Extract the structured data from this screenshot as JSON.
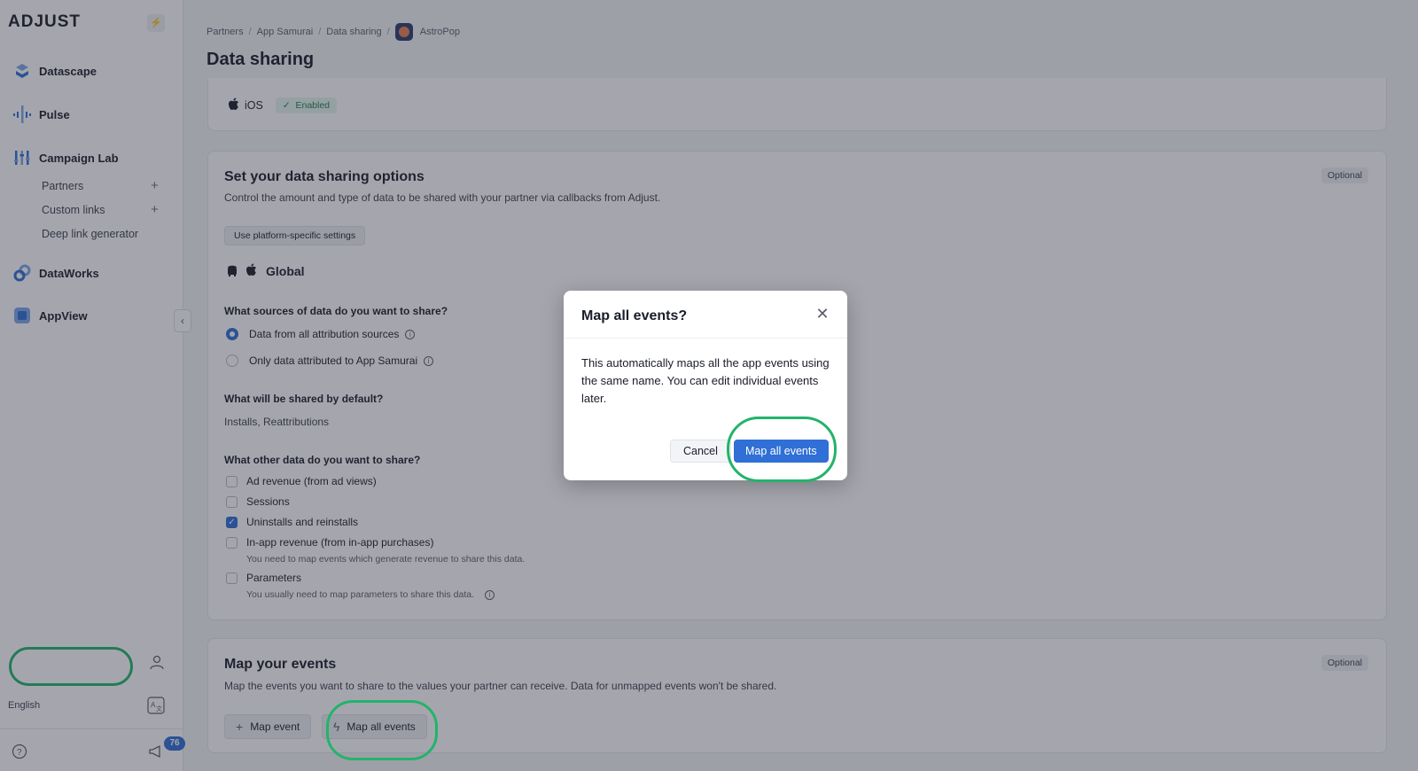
{
  "sidebar": {
    "logo": "ADJUST",
    "nav": [
      {
        "label": "Datascape",
        "icon": "datascape-icon"
      },
      {
        "label": "Pulse",
        "icon": "pulse-icon"
      },
      {
        "label": "Campaign Lab",
        "icon": "campaign-lab-icon"
      },
      {
        "label": "DataWorks",
        "icon": "dataworks-icon"
      },
      {
        "label": "AppView",
        "icon": "appview-icon"
      }
    ],
    "campaign_lab_items": [
      "Partners",
      "Custom links",
      "Deep link generator"
    ],
    "language": "English",
    "notifications_count": "76"
  },
  "breadcrumb": {
    "items": [
      "Partners",
      "App Samurai",
      "Data sharing"
    ],
    "app_name": "AstroPop"
  },
  "page": {
    "title": "Data sharing"
  },
  "platform_card": {
    "platform": "iOS",
    "status": "Enabled"
  },
  "options_card": {
    "optional": "Optional",
    "title": "Set your data sharing options",
    "description": "Control the amount and type of data to be shared with your partner via callbacks from Adjust.",
    "platform_button": "Use platform-specific settings",
    "scope_label": "Global",
    "sources_question": "What sources of data do you want to share?",
    "sources": [
      {
        "label": "Data from all attribution sources",
        "selected": true
      },
      {
        "label": "Only data attributed to App Samurai",
        "selected": false
      }
    ],
    "default_question": "What will be shared by default?",
    "default_value": "Installs, Reattributions",
    "other_question": "What other data do you want to share?",
    "other": [
      {
        "label": "Ad revenue (from ad views)",
        "checked": false
      },
      {
        "label": "Sessions",
        "checked": false
      },
      {
        "label": "Uninstalls and reinstalls",
        "checked": true
      },
      {
        "label": "In-app revenue (from in-app purchases)",
        "checked": false,
        "helper": "You need to map events which generate revenue to share this data."
      },
      {
        "label": "Parameters",
        "checked": false,
        "helper": "You usually need to map parameters to share this data."
      }
    ]
  },
  "events_card": {
    "optional": "Optional",
    "title": "Map your events",
    "description": "Map the events you want to share to the values your partner can receive. Data for unmapped events won't be shared.",
    "map_event": "Map event",
    "map_all": "Map all events"
  },
  "modal": {
    "title": "Map all events?",
    "body": "This automatically maps all the app events using the same name. You can edit individual events later.",
    "cancel": "Cancel",
    "confirm": "Map all events"
  },
  "colors": {
    "primary": "#2f6fd6",
    "highlight": "#23b36b",
    "success_bg": "#e4f4ec"
  }
}
